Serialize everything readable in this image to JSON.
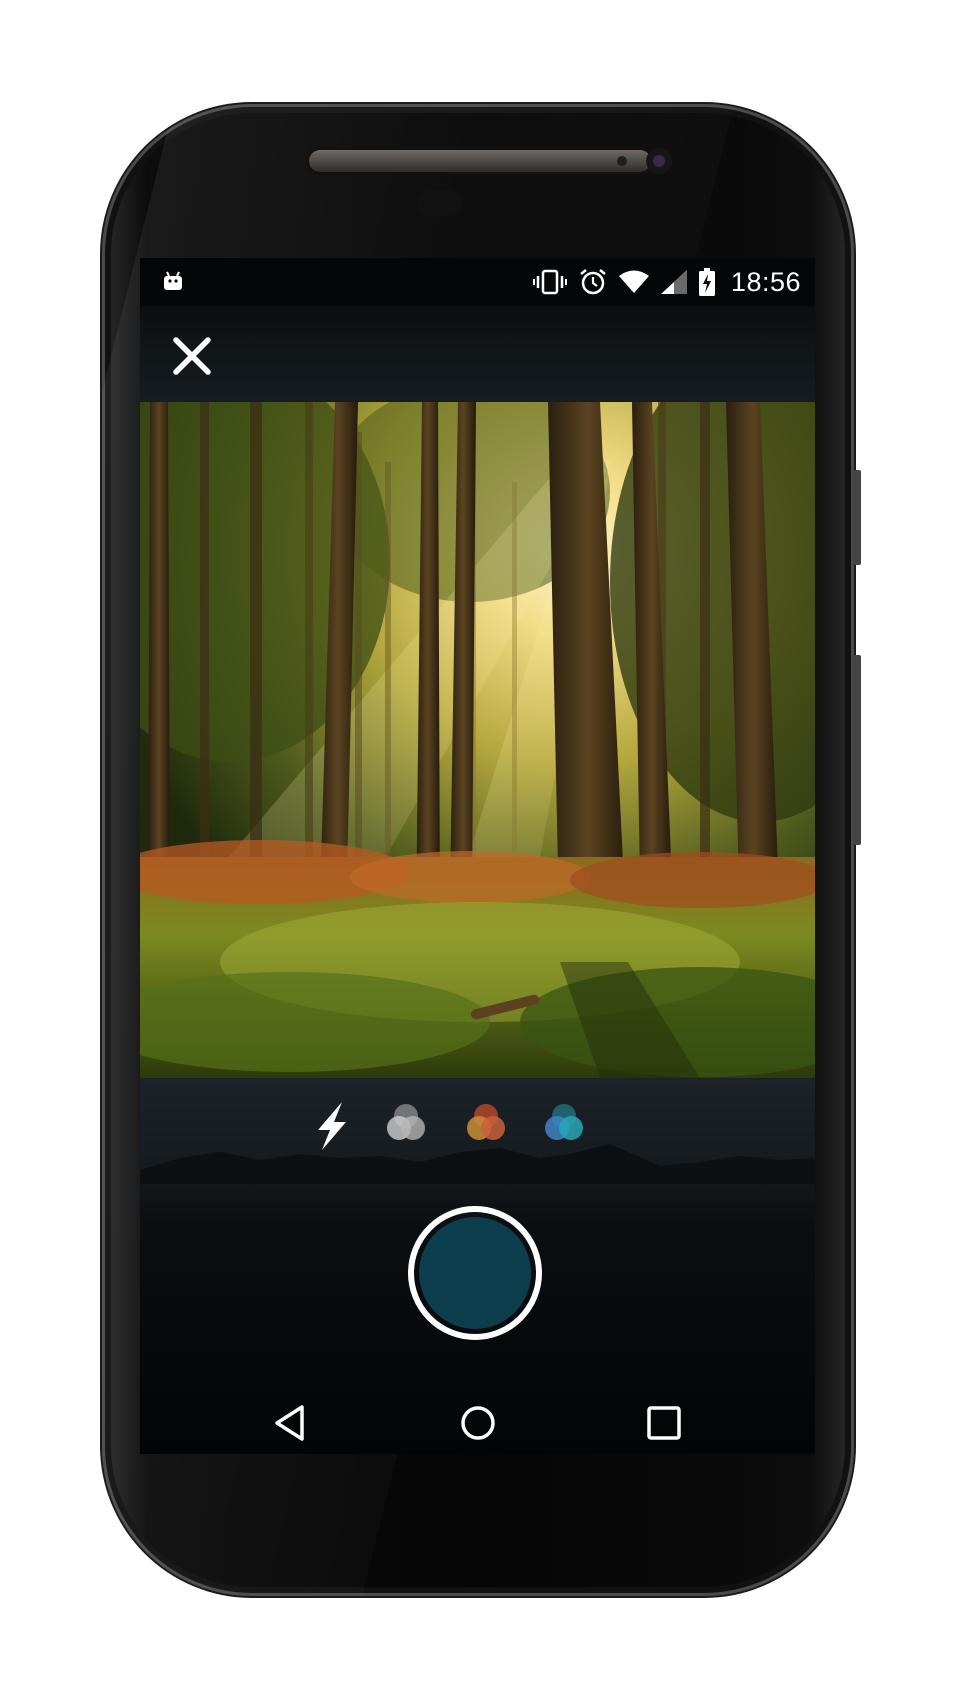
{
  "status_bar": {
    "time": "18:56",
    "left_icon": "android-debug-icon",
    "right_icons": [
      "vibrate-icon",
      "alarm-icon",
      "wifi-icon",
      "cell-signal-icon",
      "battery-charging-icon"
    ]
  },
  "app_bar": {
    "close_icon": "close-icon"
  },
  "photo": {
    "subject": "sunlit-forest-photo"
  },
  "filters": [
    {
      "name": "flash-icon",
      "colors": [
        "#ffffff"
      ]
    },
    {
      "name": "filter-mono",
      "colors": [
        "#8a8a8a",
        "#b5b5b5",
        "#cfcfcf"
      ]
    },
    {
      "name": "filter-warm",
      "colors": [
        "#b5472a",
        "#c98f36",
        "#c9623a"
      ]
    },
    {
      "name": "filter-cool",
      "colors": [
        "#1f6f7a",
        "#3f84c4",
        "#27a7b5"
      ]
    }
  ],
  "shutter": {
    "color": "#0d3e4e"
  },
  "navigation": {
    "items": [
      "back-icon",
      "home-icon",
      "recents-icon"
    ]
  },
  "colors": {
    "screen_bg": "#07090b",
    "accent": "#0d3e4e"
  }
}
